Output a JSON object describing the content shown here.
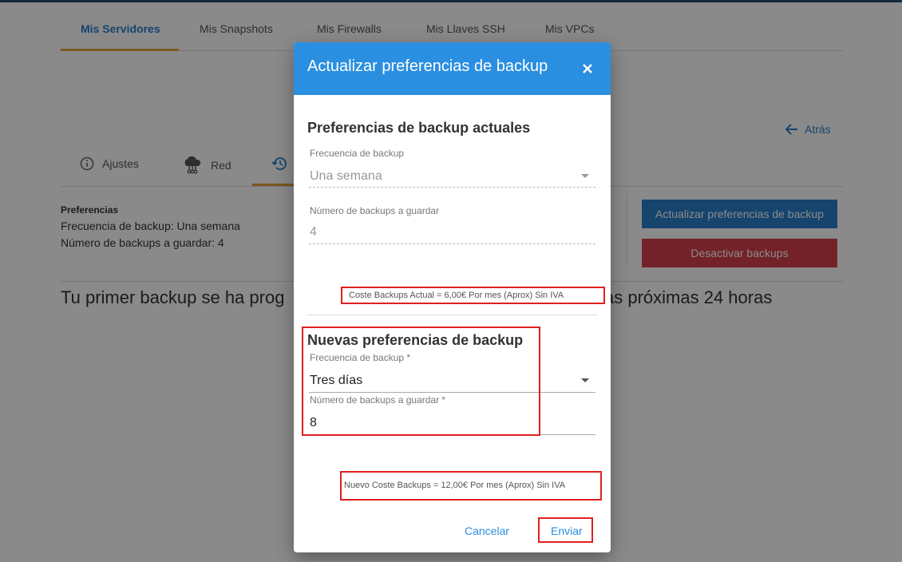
{
  "main_tabs": [
    {
      "label": "Mis Servidores"
    },
    {
      "label": "Mis Snapshots"
    },
    {
      "label": "Mis Firewalls"
    },
    {
      "label": "Mis Llaves SSH"
    },
    {
      "label": "Mis VPCs"
    }
  ],
  "back_label": "Atrás",
  "sub_tabs": [
    {
      "label": "Ajustes"
    },
    {
      "label": "Red"
    }
  ],
  "preferences": {
    "title": "Preferencias",
    "frequency_line": "Frecuencia de backup: Una semana",
    "count_line": "Número de backups a guardar: 4"
  },
  "buttons": {
    "update": "Actualizar preferencias de backup",
    "deactivate": "Desactivar backups"
  },
  "message": {
    "left": "Tu primer backup se ha prog",
    "right": "as próximas 24 horas"
  },
  "dialog": {
    "title": "Actualizar preferencias de backup",
    "current": {
      "heading": "Preferencias de backup actuales",
      "freq_label": "Frecuencia de backup",
      "freq_value": "Una semana",
      "count_label": "Número de backups a guardar",
      "count_value": "4",
      "cost": "Coste Backups Actual = 6,00€ Por mes (Aprox) Sin IVA"
    },
    "new": {
      "heading": "Nuevas preferencias de backup",
      "freq_label": "Frecuencia de backup *",
      "freq_value": "Tres días",
      "count_label": "Número de backups a guardar *",
      "count_value": "8",
      "cost": "Nuevo Coste Backups = 12,00€ Por mes (Aprox) Sin IVA"
    },
    "cancel": "Cancelar",
    "submit": "Enviar"
  },
  "colors": {
    "accent": "#2a8fe0",
    "tab_active": "#2a7fc9",
    "tab_underline": "#e6a33d",
    "danger": "#d5404c",
    "highlight": "#e02020"
  }
}
